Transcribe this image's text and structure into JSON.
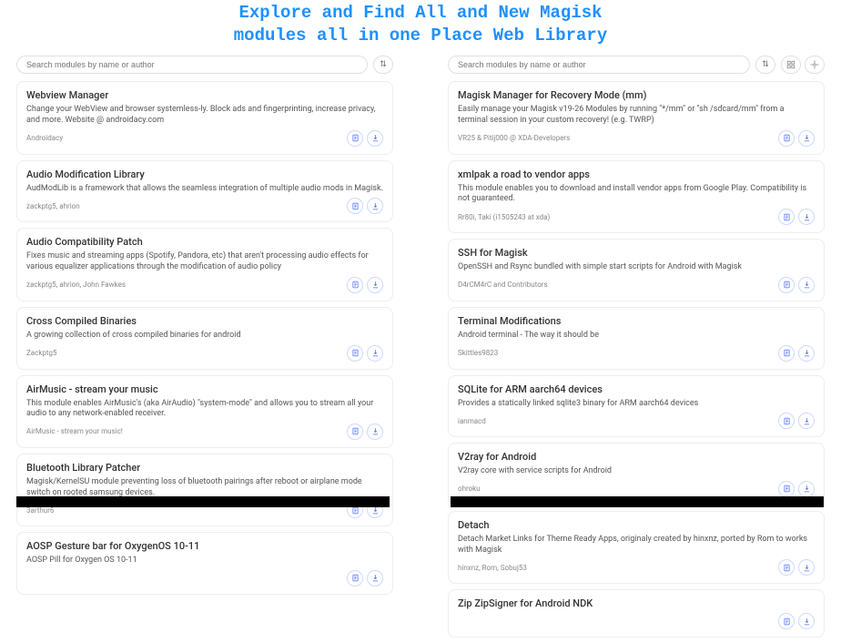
{
  "header": {
    "line1": "Explore and Find All and New Magisk",
    "line2": "modules all in one Place Web Library"
  },
  "search_placeholder": "Search modules by name or author",
  "left_modules": [
    {
      "title": "Webview Manager",
      "desc": "Change your WebView and browser systemless-ly. Block ads and fingerprinting, increase privacy, and more. Website @ androidacy.com",
      "author": "Androidacy"
    },
    {
      "title": "Audio Modification Library",
      "desc": "AudModLib is a framework that allows the seamless integration of multiple audio mods in Magisk.",
      "author": "zackptg5, ahrion"
    },
    {
      "title": "Audio Compatibility Patch",
      "desc": "Fixes music and streaming apps (Spotify, Pandora, etc) that aren't processing audio effects for various equalizer applications through the modification of audio policy",
      "author": "zackptg5, ahrion, John Fawkes"
    },
    {
      "title": "Cross Compiled Binaries",
      "desc": "A growing collection of cross compiled binaries for android",
      "author": "Zackptg5"
    },
    {
      "title": "AirMusic - stream your music",
      "desc": "This module enables AirMusic's (aka AirAudio) \"system-mode\" and allows you to stream all your audio to any network-enabled receiver.",
      "author": "AirMusic - stream your music!"
    },
    {
      "title": "Bluetooth Library Patcher",
      "desc": "Magisk/KernelSU module preventing loss of bluetooth pairings after reboot or airplane mode switch on rooted samsung devices.",
      "author": "3arthur6"
    },
    {
      "title": "AOSP Gesture bar for OxygenOS 10-11",
      "desc": "AOSP Pill for Oxygen OS 10-11",
      "author": ""
    }
  ],
  "right_modules": [
    {
      "title": "Magisk Manager for Recovery Mode (mm)",
      "desc": "Easily manage your Magisk v19-26 Modules by running \"*/mm\" or \"sh /sdcard/mm\" from a terminal session in your custom recovery! (e.g. TWRP)",
      "author": "VR25 & Pitij000 @ XDA-Developers"
    },
    {
      "title": "xmlpak a road to vendor apps",
      "desc": "This module enables you to download and install vendor apps from Google Play. Compatibility is not guaranteed.",
      "author": "Rr80i, Taki (i1505243 at xda)"
    },
    {
      "title": "SSH for Magisk",
      "desc": "OpenSSH and Rsync bundled with simple start scripts for Android with Magisk",
      "author": "D4rCM4rC and Contributors"
    },
    {
      "title": "Terminal Modifications",
      "desc": "Android terminal - The way it should be",
      "author": "Skittles9823"
    },
    {
      "title": "SQLite for ARM aarch64 devices",
      "desc": "Provides a statically linked sqlite3 binary for ARM aarch64 devices",
      "author": "ianmacd"
    },
    {
      "title": "V2ray for Android",
      "desc": "V2ray core with service scripts for Android",
      "author": "ohroku"
    },
    {
      "title": "Detach",
      "desc": "Detach Market Links for Theme Ready Apps, originaly created by hinxnz, ported by Rom to works with Magisk",
      "author": "hinxnz, Rom, Sobuj53"
    },
    {
      "title": "Zip ZipSigner for Android NDK",
      "desc": "",
      "author": ""
    }
  ]
}
